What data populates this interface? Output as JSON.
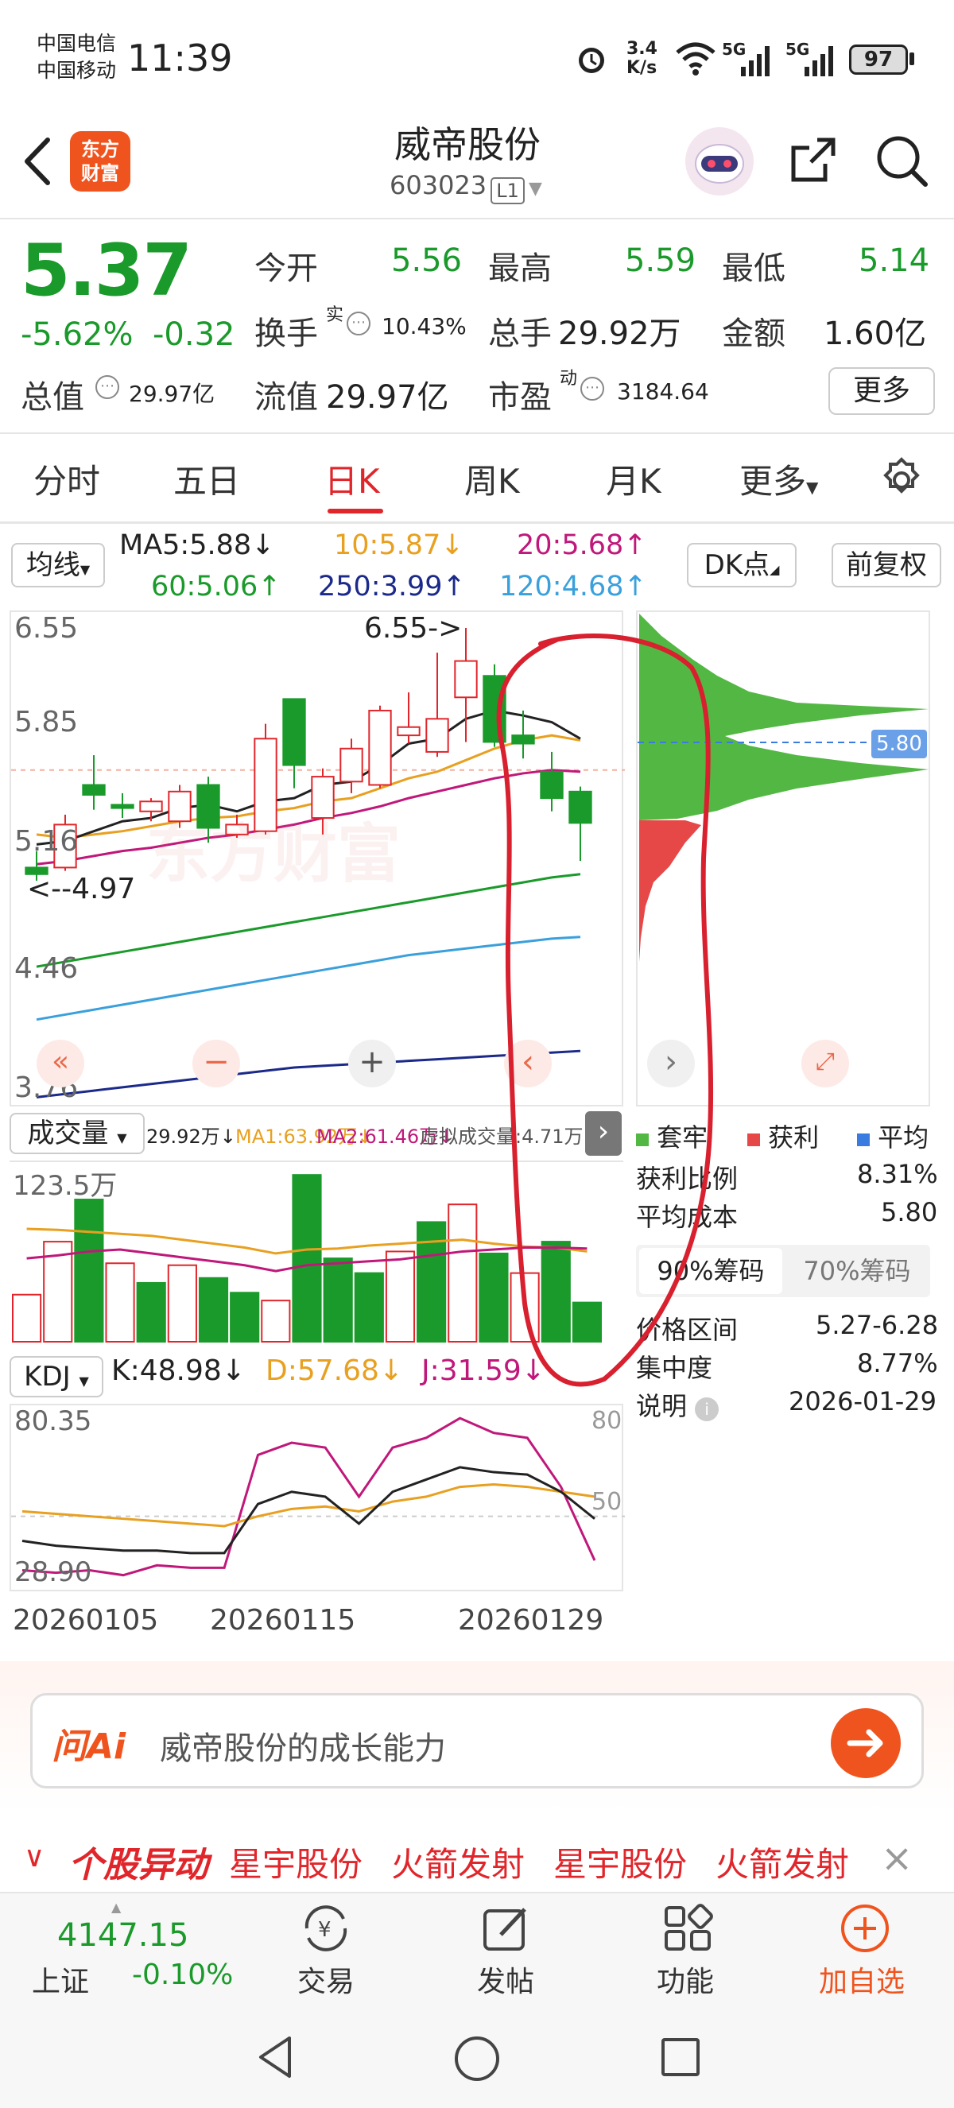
{
  "status_bar": {
    "carrier1": "中国电信",
    "carrier2": "中国移动",
    "time": "11:39",
    "speed_top": "3.4",
    "speed_bottom": "K/s",
    "net1": "5G",
    "net2": "5G",
    "battery": "97"
  },
  "header": {
    "logo_line1": "东方",
    "logo_line2": "财富",
    "title": "威帝股份",
    "code": "603023",
    "level": "L1"
  },
  "quote": {
    "price": "5.37",
    "change_pct": "-5.62%",
    "change_amt": "-0.32",
    "open_label": "今开",
    "open": "5.56",
    "high_label": "最高",
    "high": "5.59",
    "low_label": "最低",
    "low": "5.14",
    "turnover_label": "换手",
    "turnover_sup": "实",
    "turnover": "10.43%",
    "volume_label": "总手",
    "volume": "29.92万",
    "amount_label": "金额",
    "amount": "1.60亿",
    "mktcap_label": "总值",
    "mktcap": "29.97亿",
    "float_label": "流值",
    "float": "29.97亿",
    "pe_label": "市盈",
    "pe_sup": "动",
    "pe": "3184.64",
    "more": "更多"
  },
  "tabs": [
    "分时",
    "五日",
    "日K",
    "周K",
    "月K",
    "更多"
  ],
  "ma_bar": {
    "selector": "均线",
    "ma5": "MA5:5.88↓",
    "ma10": "10:5.87↓",
    "ma20": "20:5.68↑",
    "ma60": "60:5.06↑",
    "ma250": "250:3.99↑",
    "ma120": "120:4.68↑",
    "dk": "DK点",
    "fq": "前复权"
  },
  "kline": {
    "y_labels": [
      "6.55",
      "5.85",
      "5.16",
      "4.46",
      "3.76"
    ],
    "max_marker": "6.55->",
    "min_marker": "<--4.97",
    "watermark": "东方财富",
    "chip_price": "5.80",
    "candles": [
      {
        "o": 5.1,
        "h": 5.2,
        "l": 5.02,
        "c": 5.06
      },
      {
        "o": 5.1,
        "h": 5.42,
        "l": 5.08,
        "c": 5.36
      },
      {
        "o": 5.6,
        "h": 5.78,
        "l": 5.45,
        "c": 5.54
      },
      {
        "o": 5.48,
        "h": 5.55,
        "l": 5.4,
        "c": 5.46
      },
      {
        "o": 5.44,
        "h": 5.52,
        "l": 5.38,
        "c": 5.5
      },
      {
        "o": 5.38,
        "h": 5.6,
        "l": 5.34,
        "c": 5.56
      },
      {
        "o": 5.6,
        "h": 5.65,
        "l": 5.25,
        "c": 5.34
      },
      {
        "o": 5.3,
        "h": 5.42,
        "l": 5.28,
        "c": 5.36
      },
      {
        "o": 5.32,
        "h": 5.97,
        "l": 5.3,
        "c": 5.88
      },
      {
        "o": 6.12,
        "h": 6.12,
        "l": 5.58,
        "c": 5.72
      },
      {
        "o": 5.4,
        "h": 5.7,
        "l": 5.3,
        "c": 5.65
      },
      {
        "o": 5.62,
        "h": 5.88,
        "l": 5.55,
        "c": 5.82
      },
      {
        "o": 5.6,
        "h": 6.08,
        "l": 5.58,
        "c": 6.05
      },
      {
        "o": 5.9,
        "h": 6.16,
        "l": 5.85,
        "c": 5.95
      },
      {
        "o": 5.8,
        "h": 6.4,
        "l": 5.77,
        "c": 6.0
      },
      {
        "o": 6.13,
        "h": 6.55,
        "l": 5.86,
        "c": 6.35
      },
      {
        "o": 6.26,
        "h": 6.33,
        "l": 5.83,
        "c": 5.86
      },
      {
        "o": 5.9,
        "h": 6.05,
        "l": 5.76,
        "c": 5.85
      },
      {
        "o": 5.68,
        "h": 5.8,
        "l": 5.44,
        "c": 5.52
      },
      {
        "o": 5.56,
        "h": 5.59,
        "l": 5.14,
        "c": 5.37
      }
    ],
    "ma5": [
      5.24,
      5.26,
      5.32,
      5.38,
      5.4,
      5.46,
      5.48,
      5.44,
      5.5,
      5.52,
      5.6,
      5.62,
      5.72,
      5.85,
      5.88,
      6.0,
      6.05,
      6.02,
      5.98,
      5.88
    ],
    "ma10": [
      5.3,
      5.28,
      5.3,
      5.32,
      5.35,
      5.38,
      5.4,
      5.41,
      5.44,
      5.46,
      5.5,
      5.52,
      5.58,
      5.64,
      5.68,
      5.75,
      5.82,
      5.87,
      5.9,
      5.87
    ],
    "ma20": [
      5.12,
      5.14,
      5.17,
      5.2,
      5.22,
      5.25,
      5.28,
      5.3,
      5.33,
      5.36,
      5.4,
      5.43,
      5.47,
      5.52,
      5.56,
      5.6,
      5.64,
      5.67,
      5.69,
      5.68
    ],
    "ma60": [
      4.5,
      4.53,
      4.56,
      4.59,
      4.62,
      4.65,
      4.68,
      4.71,
      4.74,
      4.77,
      4.8,
      4.83,
      4.86,
      4.89,
      4.92,
      4.95,
      4.98,
      5.01,
      5.04,
      5.06
    ],
    "ma120": [
      4.18,
      4.21,
      4.24,
      4.27,
      4.3,
      4.33,
      4.36,
      4.39,
      4.42,
      4.45,
      4.48,
      4.51,
      4.54,
      4.57,
      4.59,
      4.61,
      4.63,
      4.65,
      4.67,
      4.68
    ],
    "ma250": [
      3.71,
      3.73,
      3.75,
      3.77,
      3.79,
      3.81,
      3.83,
      3.85,
      3.87,
      3.89,
      3.9,
      3.91,
      3.92,
      3.93,
      3.94,
      3.95,
      3.96,
      3.97,
      3.98,
      3.99
    ]
  },
  "volume": {
    "selector": "成交量",
    "info": "29.92万↓",
    "ma1": "MA1:63.92万↓",
    "ma2": "MA2:61.46万↓",
    "virtual": "虚拟成交量:4.71万",
    "y_max": "123.5万",
    "bars": [
      {
        "v": 48,
        "up": true
      },
      {
        "v": 102,
        "up": true
      },
      {
        "v": 145,
        "up": false
      },
      {
        "v": 80,
        "up": true
      },
      {
        "v": 60,
        "up": false
      },
      {
        "v": 78,
        "up": true
      },
      {
        "v": 65,
        "up": false
      },
      {
        "v": 50,
        "up": false
      },
      {
        "v": 42,
        "up": true
      },
      {
        "v": 170,
        "up": false
      },
      {
        "v": 85,
        "up": false
      },
      {
        "v": 70,
        "up": false
      },
      {
        "v": 92,
        "up": true
      },
      {
        "v": 122,
        "up": false
      },
      {
        "v": 140,
        "up": true
      },
      {
        "v": 90,
        "up": false
      },
      {
        "v": 70,
        "up": true
      },
      {
        "v": 102,
        "up": false
      },
      {
        "v": 40,
        "up": false
      }
    ],
    "ma1_line": [
      115,
      114,
      112,
      110,
      108,
      104,
      100,
      96,
      90,
      94,
      95,
      98,
      100,
      102,
      104,
      100,
      97,
      96,
      92
    ],
    "ma2_line": [
      85,
      88,
      92,
      94,
      90,
      86,
      82,
      78,
      72,
      78,
      80,
      82,
      84,
      88,
      92,
      94,
      96,
      96,
      95
    ]
  },
  "kdj": {
    "selector": "KDJ",
    "k": "K:48.98↓",
    "d": "D:57.68↓",
    "j": "J:31.59↓",
    "y_top": "80.35",
    "y_bottom": "28.90",
    "right_top": "80",
    "right_mid": "50",
    "dates": [
      "20260105",
      "20260115",
      "20260129"
    ],
    "k_line": [
      40,
      38,
      37,
      36,
      36,
      35,
      35,
      55,
      60,
      58,
      47,
      60,
      65,
      70,
      68,
      67,
      60,
      49
    ],
    "d_line": [
      52,
      51,
      50,
      49,
      48,
      47,
      46,
      50,
      53,
      54,
      52,
      56,
      58,
      62,
      63,
      62,
      60,
      58
    ],
    "j_line": [
      28,
      27,
      28,
      26,
      30,
      29,
      29,
      75,
      80,
      78,
      58,
      78,
      82,
      90,
      84,
      82,
      62,
      32
    ]
  },
  "chips": {
    "legend_trapped": "套牢",
    "legend_profit": "获利",
    "legend_avg": "平均",
    "profit_ratio_label": "获利比例",
    "profit_ratio": "8.31%",
    "avg_cost_label": "平均成本",
    "avg_cost": "5.80",
    "tab90": "90%筹码",
    "tab70": "70%筹码",
    "range_label": "价格区间",
    "range": "5.27-6.28",
    "concentration_label": "集中度",
    "concentration": "8.77%",
    "note_label": "说明",
    "note_date": "2026-01-29"
  },
  "ai_bar": {
    "logo": "问Ai",
    "placeholder": "威帝股份的成长能力"
  },
  "ticker": {
    "label": "个股异动",
    "items": [
      "星宇股份",
      "火箭发射",
      "星宇股份",
      "火箭发射"
    ]
  },
  "bottom_nav": {
    "index_value": "4147.15",
    "index_name": "上证",
    "index_change": "-0.10%",
    "trade": "交易",
    "post": "发帖",
    "func": "功能",
    "add": "加自选"
  },
  "colors": {
    "up_red": "#e0262b",
    "down_green": "#1a9a2a",
    "annotation": "#d8202f"
  }
}
